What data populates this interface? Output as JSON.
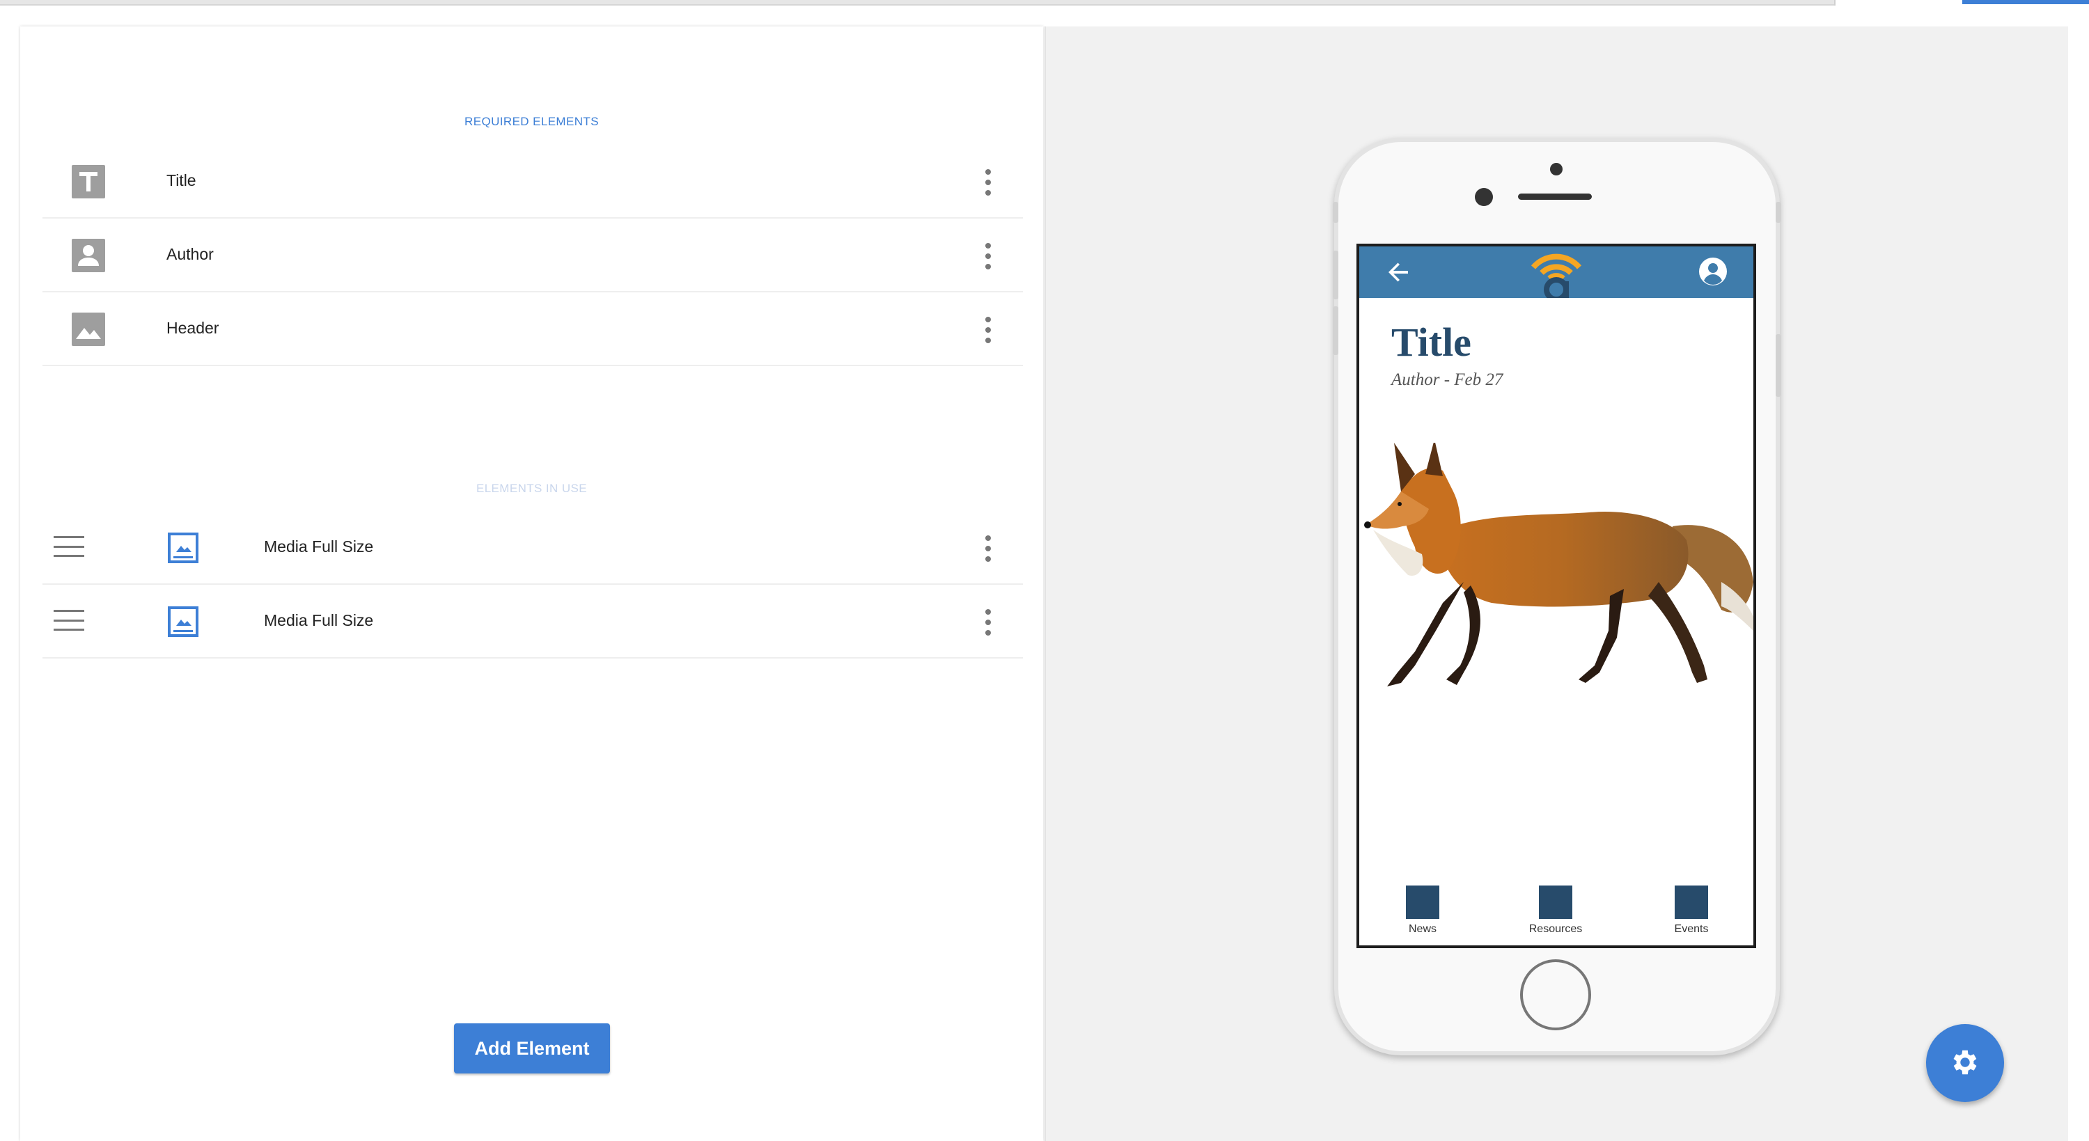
{
  "colors": {
    "accent": "#3d7fd6",
    "app_bar": "#3f7cab",
    "navy": "#274b6b",
    "logo_orange": "#f5a623"
  },
  "required_section": {
    "heading": "REQUIRED ELEMENTS",
    "items": [
      {
        "label": "Title",
        "icon": "title-icon"
      },
      {
        "label": "Author",
        "icon": "person-icon"
      },
      {
        "label": "Header",
        "icon": "image-icon"
      }
    ]
  },
  "in_use_section": {
    "heading": "ELEMENTS IN USE",
    "items": [
      {
        "label": "Media Full Size",
        "icon": "media-full-size-icon"
      },
      {
        "label": "Media Full Size",
        "icon": "media-full-size-icon"
      }
    ]
  },
  "add_button": {
    "label": "Add Element"
  },
  "preview": {
    "article_title": "Title",
    "article_meta": "Author - Feb 27",
    "media_subject": "fox-photo",
    "bottom_nav": [
      {
        "label": "News"
      },
      {
        "label": "Resources"
      },
      {
        "label": "Events"
      }
    ]
  },
  "fab": {
    "icon": "gear-icon"
  }
}
